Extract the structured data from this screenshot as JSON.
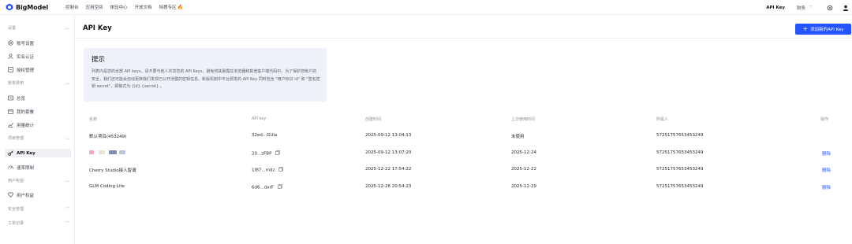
{
  "topbar": {
    "logo": "BigModel",
    "nav": [
      "控制台",
      "应用空间",
      "体验中心",
      "开放文档",
      "特惠专区"
    ],
    "fire_icon": "fire-icon",
    "right": {
      "api_key": "API Key",
      "finance": "财务"
    }
  },
  "sidebar": {
    "groups": [
      {
        "label": "设置",
        "items": [
          {
            "label": "账号设置",
            "icon": "settings-icon"
          },
          {
            "label": "实名认证",
            "icon": "user-icon"
          },
          {
            "label": "授权管理",
            "icon": "auth-icon"
          }
        ]
      },
      {
        "label": "账单费用",
        "items": [
          {
            "label": "总览",
            "icon": "overview-icon"
          },
          {
            "label": "我的套餐",
            "icon": "package-icon"
          },
          {
            "label": "用量统计",
            "icon": "chart-icon"
          }
        ]
      },
      {
        "label": "项目管理",
        "items": [
          {
            "label": "API Key",
            "icon": "key-icon",
            "active": true
          },
          {
            "label": "速率限制",
            "icon": "speed-icon"
          }
        ]
      },
      {
        "label": "用户权益",
        "items": [
          {
            "label": "用户权益",
            "icon": "heart-icon"
          }
        ]
      },
      {
        "label": "安全管理",
        "items": []
      },
      {
        "label": "工单记录",
        "items": []
      }
    ]
  },
  "main": {
    "title": "API Key",
    "add_button": "添加新的API Key",
    "tip": {
      "title": "提示",
      "body": "列表内是您的全部 API keys，请不要与他人共享您的 API Keys，避免将其暴露在浏览器和其他客户端代码中。为了保护您帐户的安全，我们还可能会自动更换我们发现已公开泄露的密钥信息。新版机制中平台颁发的 API Key 同时包含 \"用户标识 id\" 和 \"签名密钥 secret\"，即格式为 {id}.{secret} 。"
    },
    "table": {
      "headers": [
        "名称",
        "API key",
        "创建时间",
        "上次使用时间",
        "所属人",
        "操作"
      ],
      "rows": [
        {
          "name": "默认项目(453249)",
          "key": "32ed...GUia",
          "created": "2025-09-12 13:04:13",
          "last_used": "未使用",
          "owner": "57251757653453249",
          "action": ""
        },
        {
          "name": "",
          "key": "20...zFBP",
          "created": "2025-09-12 13:07:20",
          "last_used": "2025-12-24",
          "owner": "57251757653453249",
          "action": "删除"
        },
        {
          "name": "Cherry Studio接入智谱",
          "key": "1f87...mdz",
          "created": "2025-12-22 17:54:22",
          "last_used": "2025-12-22",
          "owner": "57251757653453249",
          "action": "删除"
        },
        {
          "name": "GLM Coding Lite",
          "key": "6d6...dxrF",
          "created": "2025-12-26 20:54:23",
          "last_used": "2025-12-29",
          "owner": "57251757653453249",
          "action": "删除"
        }
      ]
    }
  },
  "colors": {
    "accent": "#2454ff",
    "tip_bg": "#eef1f8"
  }
}
